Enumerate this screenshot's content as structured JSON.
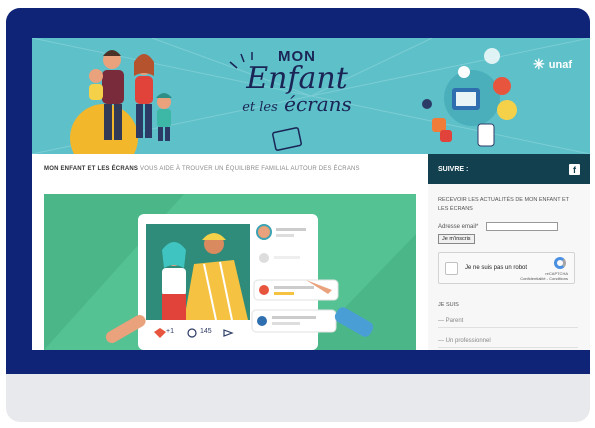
{
  "banner": {
    "title_mon": "MON",
    "title_enfant": "Enfant",
    "title_et_les": "et les",
    "title_ecrans": "écrans",
    "partner": "unaf"
  },
  "tagline": {
    "brand": "MON ENFANT ET LES ÉCRANS",
    "text": "VOUS AIDE À TROUVER UN ÉQUILIBRE FAMILIAL AUTOUR DES ÉCRANS"
  },
  "hero": {
    "likes": "+1",
    "comments": "145"
  },
  "sidebar": {
    "follow_label": "SUIVRE :",
    "facebook_icon": "facebook-icon",
    "newsletter_title": "RECEVOIR LES ACTUALITÉS DE MON ENFANT ET LES ÉCRANS",
    "email_label": "Adresse email*",
    "email_value": "",
    "subscribe_label": "Je m'inscris",
    "captcha_text": "Je ne suis pas un robot",
    "captcha_brand": "reCAPTCHA",
    "captcha_sub": "Confidentialité - Conditions",
    "section_title": "JE SUIS",
    "links": [
      "— Parent",
      "— Un professionnel"
    ]
  },
  "colors": {
    "frame_navy": "#0f2477",
    "banner_teal": "#5ec0c9",
    "hero_green": "#54c292",
    "sidebar_header": "#13404f"
  }
}
